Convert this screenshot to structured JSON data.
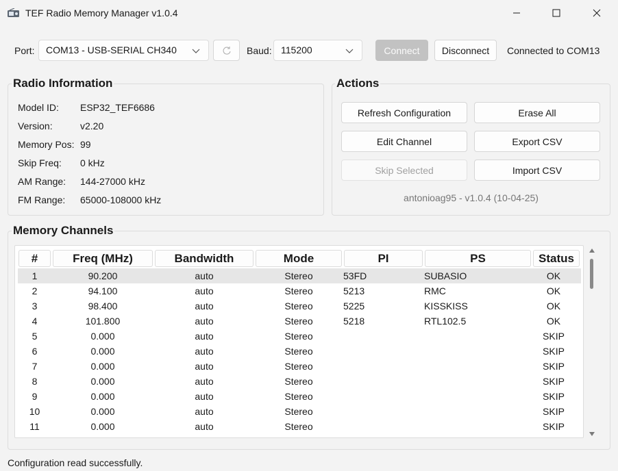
{
  "window": {
    "title": "TEF Radio Memory Manager v1.0.4",
    "app_icon": "radio-icon",
    "controls": [
      "minimize-icon",
      "maximize-icon",
      "close-icon"
    ]
  },
  "toolbar": {
    "port_label": "Port:",
    "port_value": "COM13 - USB-SERIAL CH340",
    "refresh_icon": "refresh-icon",
    "baud_label": "Baud:",
    "baud_value": "115200",
    "connect_label": "Connect",
    "disconnect_label": "Disconnect",
    "connection_status": "Connected to COM13"
  },
  "radio_info": {
    "title": "Radio Information",
    "fields": [
      {
        "label": "Model ID:",
        "value": "ESP32_TEF6686"
      },
      {
        "label": "Version:",
        "value": "v2.20"
      },
      {
        "label": "Memory Pos:",
        "value": "99"
      },
      {
        "label": "Skip Freq:",
        "value": "0 kHz"
      },
      {
        "label": "AM Range:",
        "value": "144-27000 kHz"
      },
      {
        "label": "FM Range:",
        "value": "65000-108000 kHz"
      }
    ]
  },
  "actions": {
    "title": "Actions",
    "refresh_configuration": "Refresh Configuration",
    "erase_all": "Erase All",
    "edit_channel": "Edit Channel",
    "export_csv": "Export CSV",
    "skip_selected": "Skip Selected",
    "import_csv": "Import CSV",
    "version_text": "antonioag95 - v1.0.4 (10-04-25)"
  },
  "memory_channels": {
    "title": "Memory Channels",
    "columns": [
      "#",
      "Freq (MHz)",
      "Bandwidth",
      "Mode",
      "PI",
      "PS",
      "Status"
    ],
    "rows": [
      [
        "1",
        "90.200",
        "auto",
        "Stereo",
        "53FD",
        "SUBASIO",
        "OK"
      ],
      [
        "2",
        "94.100",
        "auto",
        "Stereo",
        "5213",
        "RMC",
        "OK"
      ],
      [
        "3",
        "98.400",
        "auto",
        "Stereo",
        "5225",
        "KISSKISS",
        "OK"
      ],
      [
        "4",
        "101.800",
        "auto",
        "Stereo",
        "5218",
        "RTL102.5",
        "OK"
      ],
      [
        "5",
        "0.000",
        "auto",
        "Stereo",
        "",
        "",
        "SKIP"
      ],
      [
        "6",
        "0.000",
        "auto",
        "Stereo",
        "",
        "",
        "SKIP"
      ],
      [
        "7",
        "0.000",
        "auto",
        "Stereo",
        "",
        "",
        "SKIP"
      ],
      [
        "8",
        "0.000",
        "auto",
        "Stereo",
        "",
        "",
        "SKIP"
      ],
      [
        "9",
        "0.000",
        "auto",
        "Stereo",
        "",
        "",
        "SKIP"
      ],
      [
        "10",
        "0.000",
        "auto",
        "Stereo",
        "",
        "",
        "SKIP"
      ],
      [
        "11",
        "0.000",
        "auto",
        "Stereo",
        "",
        "",
        "SKIP"
      ]
    ],
    "selected_row": "1"
  },
  "status_bar": {
    "message": "Configuration read successfully."
  },
  "colors": {
    "background": "#f3f3f3",
    "selected_row": "#e6e6e6",
    "disabled_primary": "#c2c2c2",
    "muted_text": "#767676"
  }
}
